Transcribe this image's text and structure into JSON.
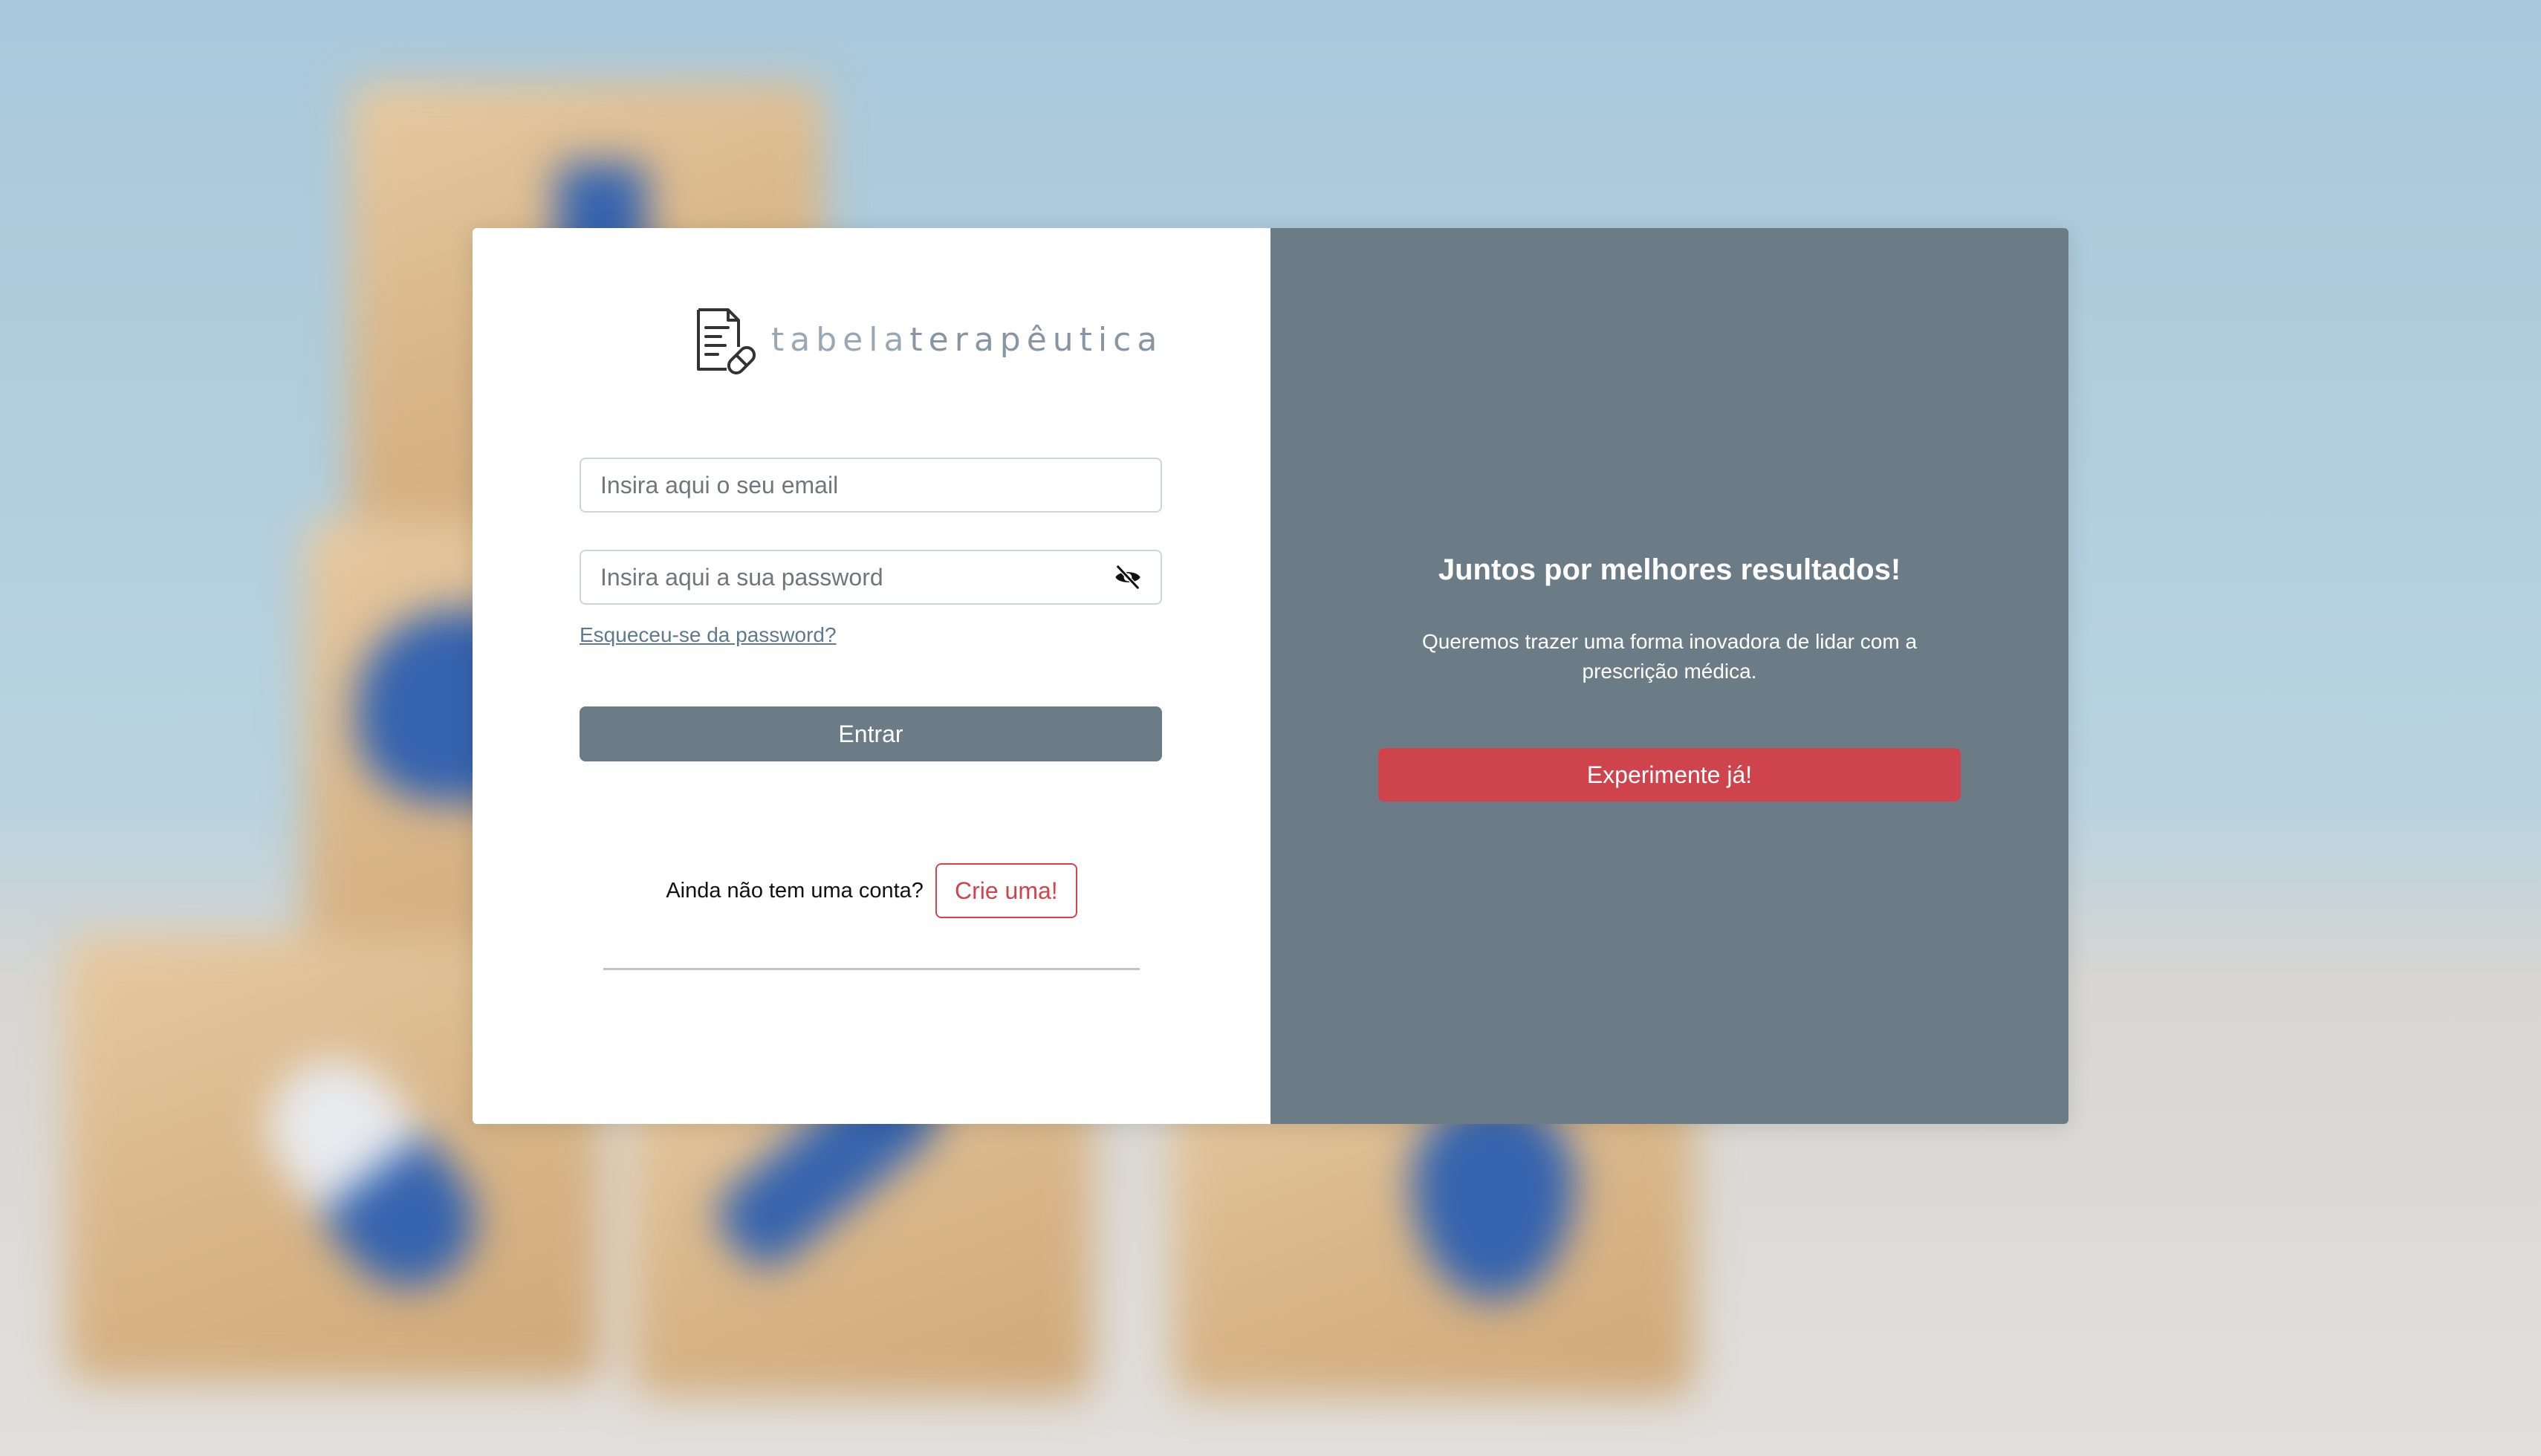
{
  "logo": {
    "text_light": "tabela",
    "text_bold": "terapêutica"
  },
  "login": {
    "email_placeholder": "Insira aqui o seu email",
    "password_placeholder": "Insira aqui a sua password",
    "forgot_label": "Esqueceu-se da password?",
    "submit_label": "Entrar"
  },
  "signup": {
    "prompt": "Ainda não tem uma conta?",
    "button_label": "Crie uma!"
  },
  "promo": {
    "title": "Juntos por melhores resultados!",
    "text": "Queremos trazer uma forma inovadora de lidar com a prescrição médica.",
    "button_label": "Experimente já!"
  },
  "icons": {
    "logo": "prescription-document-icon",
    "password_toggle": "eye-slash-icon"
  },
  "colors": {
    "panel_gray": "#6c7c86",
    "accent_red": "#cf444c",
    "logo_text": "#9aa7b5"
  }
}
